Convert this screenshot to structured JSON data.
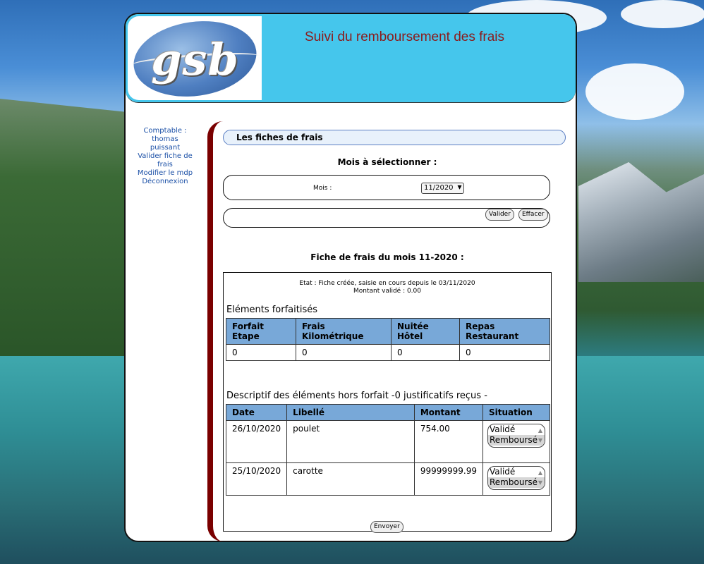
{
  "header": {
    "logo_text": "gsb",
    "title": "Suivi du remboursement des frais"
  },
  "menu": {
    "role": "Comptable :",
    "user": "thomas puissant",
    "items": [
      "Valider fiche de frais",
      "Modifier le mdp",
      "Déconnexion"
    ]
  },
  "section": {
    "title": "Les fiches de frais",
    "mois_prompt": "Mois à sélectionner :"
  },
  "form": {
    "mois_label": "Mois :",
    "mois_value": "11/2020",
    "valider_label": "Valider",
    "effacer_label": "Effacer"
  },
  "fiche": {
    "title": "Fiche de frais du mois 11-2020 :",
    "etat": "Etat : Fiche créée, saisie en cours depuis le 03/11/2020",
    "montant": "Montant validé : 0.00",
    "forfait_heading": "Eléments forfaitisés",
    "forfait_headers": [
      "Forfait Etape",
      "Frais Kilométrique",
      "Nuitée Hôtel",
      "Repas Restaurant"
    ],
    "forfait_values": [
      "0",
      "0",
      "0",
      "0"
    ],
    "hors_forfait_heading": "Descriptif des éléments hors forfait -0 justificatifs reçus -",
    "hors_headers": [
      "Date",
      "Libellé",
      "Montant",
      "Situation"
    ],
    "hors_rows": [
      {
        "date": "26/10/2020",
        "libelle": "poulet",
        "montant": "754.00",
        "options": [
          "Validé",
          "Remboursé"
        ]
      },
      {
        "date": "25/10/2020",
        "libelle": "carotte",
        "montant": "99999999.99",
        "options": [
          "Validé",
          "Remboursé"
        ]
      }
    ],
    "envoyer_label": "Envoyer"
  },
  "colors": {
    "header_bg": "#45c6ec",
    "title": "#8b1a1a",
    "accent_border": "#7a0000",
    "table_header": "#78a8d8"
  }
}
